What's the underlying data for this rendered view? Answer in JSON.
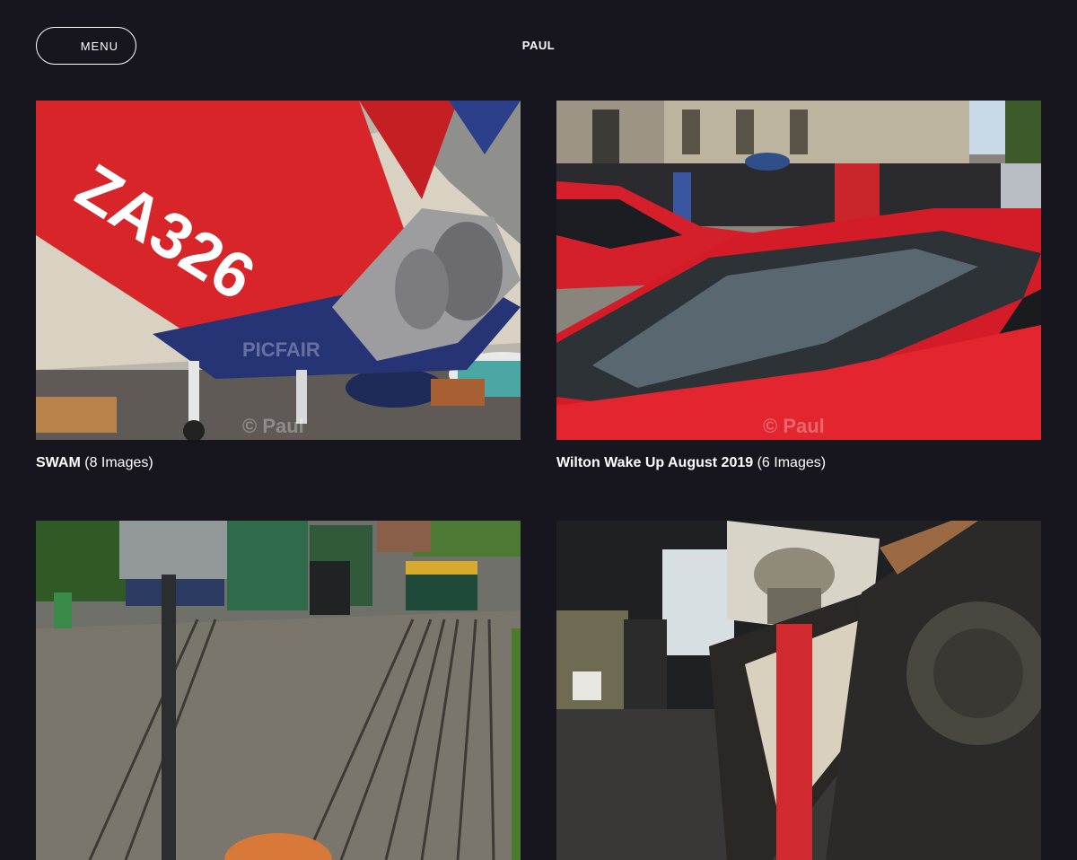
{
  "header": {
    "menu_label": "MENU",
    "site_title": "PAUL"
  },
  "gallery": [
    {
      "title": "SWAM",
      "count": "(8 Images)",
      "image_alt": "Red aircraft tail with ZA326 marking inside a museum hangar",
      "tail_code": "ZA326",
      "watermark": "© Paul",
      "watermark_brand": "PICFAIR"
    },
    {
      "title": "Wilton Wake Up August 2019",
      "count": "(6 Images)",
      "image_alt": "Rain-covered red Ferrari in front of a stone house with crowd",
      "watermark": "© Paul"
    },
    {
      "title": "",
      "count": "",
      "image_alt": "Railway yard with tracks and diesel locomotives at a station"
    },
    {
      "title": "",
      "count": "",
      "image_alt": "Museum tank exhibit with a soldier portrait in the background"
    }
  ],
  "colors": {
    "background": "#17151e",
    "text": "#ffffff"
  }
}
